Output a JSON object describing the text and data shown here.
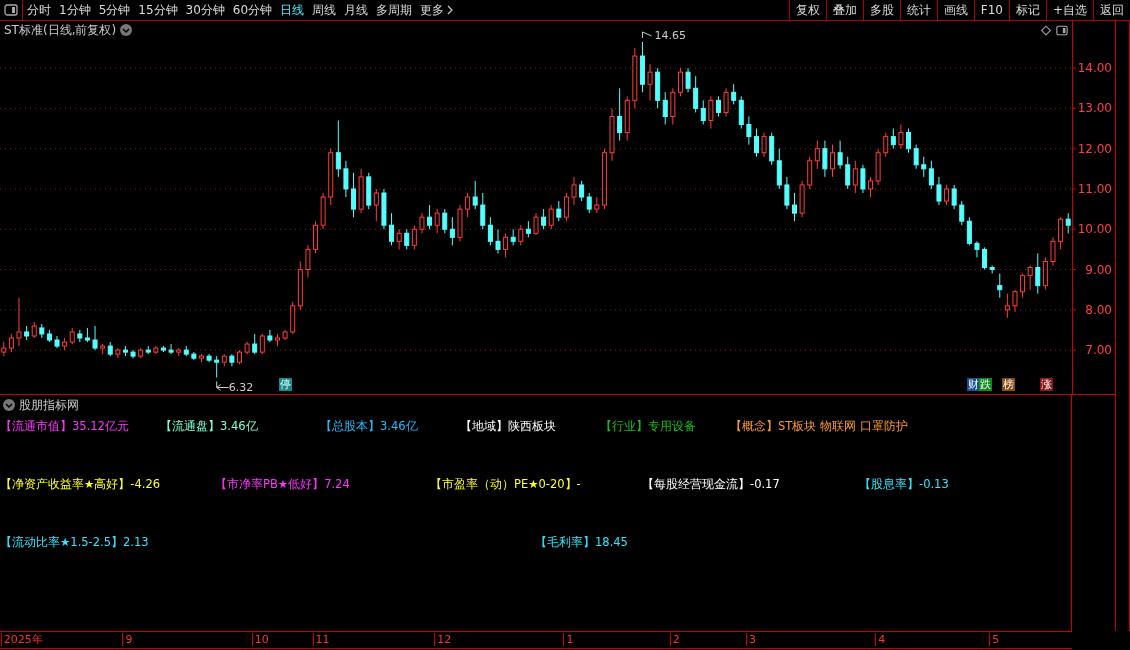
{
  "toolbar": {
    "periods": [
      {
        "label": "分时",
        "selected": false
      },
      {
        "label": "1分钟",
        "selected": false
      },
      {
        "label": "5分钟",
        "selected": false
      },
      {
        "label": "15分钟",
        "selected": false
      },
      {
        "label": "30分钟",
        "selected": false
      },
      {
        "label": "60分钟",
        "selected": false
      },
      {
        "label": "日线",
        "selected": true
      },
      {
        "label": "周线",
        "selected": false
      },
      {
        "label": "月线",
        "selected": false
      },
      {
        "label": "多周期",
        "selected": false
      }
    ],
    "more": "更多",
    "buttons": [
      "复权",
      "叠加",
      "多股",
      "统计",
      "画线",
      "F10",
      "标记",
      "+自选",
      "返回"
    ]
  },
  "chart": {
    "title": "ST标准(日线,前复权)",
    "chart_data": {
      "type": "candlestick",
      "grid": true,
      "ohlc": [
        [
          6.95,
          7.2,
          6.85,
          7.05
        ],
        [
          7.05,
          7.4,
          6.95,
          7.3
        ],
        [
          7.3,
          8.3,
          7.1,
          7.45
        ],
        [
          7.45,
          7.6,
          7.25,
          7.35
        ],
        [
          7.35,
          7.7,
          7.3,
          7.6
        ],
        [
          7.55,
          7.65,
          7.3,
          7.4
        ],
        [
          7.4,
          7.5,
          7.2,
          7.25
        ],
        [
          7.25,
          7.35,
          7.05,
          7.1
        ],
        [
          7.1,
          7.3,
          7.0,
          7.2
        ],
        [
          7.2,
          7.55,
          7.15,
          7.45
        ],
        [
          7.4,
          7.5,
          7.2,
          7.3
        ],
        [
          7.3,
          7.55,
          7.2,
          7.25
        ],
        [
          7.25,
          7.6,
          7.0,
          7.05
        ],
        [
          7.05,
          7.15,
          6.9,
          7.1
        ],
        [
          7.1,
          7.2,
          6.85,
          6.9
        ],
        [
          6.9,
          7.05,
          6.8,
          7.0
        ],
        [
          7.0,
          7.1,
          6.85,
          6.95
        ],
        [
          6.95,
          7.0,
          6.8,
          6.85
        ],
        [
          6.85,
          7.05,
          6.8,
          7.0
        ],
        [
          7.0,
          7.1,
          6.9,
          6.95
        ],
        [
          6.95,
          7.1,
          6.9,
          7.05
        ],
        [
          7.05,
          7.1,
          6.95,
          7.0
        ],
        [
          7.0,
          7.15,
          6.9,
          6.95
        ],
        [
          6.95,
          7.05,
          6.85,
          7.0
        ],
        [
          7.0,
          7.1,
          6.85,
          6.9
        ],
        [
          6.9,
          6.95,
          6.75,
          6.8
        ],
        [
          6.8,
          6.9,
          6.7,
          6.85
        ],
        [
          6.85,
          6.9,
          6.7,
          6.75
        ],
        [
          6.75,
          6.85,
          6.32,
          6.7
        ],
        [
          6.7,
          6.9,
          6.6,
          6.85
        ],
        [
          6.85,
          6.9,
          6.6,
          6.7
        ],
        [
          6.7,
          7.0,
          6.65,
          6.95
        ],
        [
          6.95,
          7.2,
          6.9,
          7.15
        ],
        [
          7.15,
          7.4,
          6.9,
          6.95
        ],
        [
          6.95,
          7.4,
          6.9,
          7.35
        ],
        [
          7.35,
          7.5,
          7.2,
          7.25
        ],
        [
          7.25,
          7.4,
          7.1,
          7.3
        ],
        [
          7.3,
          7.5,
          7.25,
          7.45
        ],
        [
          7.45,
          8.2,
          7.4,
          8.1
        ],
        [
          8.1,
          9.2,
          8.0,
          9.0
        ],
        [
          9.0,
          9.6,
          8.8,
          9.5
        ],
        [
          9.5,
          10.2,
          9.4,
          10.1
        ],
        [
          10.1,
          10.9,
          10.0,
          10.8
        ],
        [
          10.8,
          12.0,
          10.6,
          11.9
        ],
        [
          11.9,
          12.7,
          11.3,
          11.5
        ],
        [
          11.5,
          11.7,
          10.8,
          11.0
        ],
        [
          11.0,
          11.4,
          10.3,
          10.5
        ],
        [
          10.5,
          11.5,
          10.4,
          11.3
        ],
        [
          11.3,
          11.4,
          10.5,
          10.6
        ],
        [
          10.6,
          11.0,
          10.2,
          10.9
        ],
        [
          10.9,
          11.0,
          10.0,
          10.1
        ],
        [
          10.1,
          10.4,
          9.6,
          9.7
        ],
        [
          9.7,
          10.0,
          9.5,
          9.9
        ],
        [
          9.9,
          10.0,
          9.5,
          9.6
        ],
        [
          9.6,
          10.1,
          9.5,
          10.0
        ],
        [
          10.0,
          10.4,
          9.9,
          10.3
        ],
        [
          10.3,
          10.6,
          10.0,
          10.1
        ],
        [
          10.1,
          10.5,
          9.9,
          10.4
        ],
        [
          10.4,
          10.5,
          9.9,
          10.0
        ],
        [
          10.0,
          10.3,
          9.6,
          9.8
        ],
        [
          9.8,
          10.6,
          9.7,
          10.5
        ],
        [
          10.5,
          10.9,
          10.3,
          10.8
        ],
        [
          10.8,
          11.2,
          10.5,
          10.6
        ],
        [
          10.6,
          10.9,
          10.0,
          10.1
        ],
        [
          10.1,
          10.3,
          9.6,
          9.7
        ],
        [
          9.7,
          10.0,
          9.4,
          9.5
        ],
        [
          9.5,
          9.9,
          9.3,
          9.8
        ],
        [
          9.8,
          10.0,
          9.6,
          9.7
        ],
        [
          9.7,
          10.1,
          9.6,
          10.0
        ],
        [
          10.0,
          10.2,
          9.8,
          9.9
        ],
        [
          9.9,
          10.4,
          9.85,
          10.3
        ],
        [
          10.3,
          10.5,
          10.0,
          10.1
        ],
        [
          10.1,
          10.6,
          10.0,
          10.5
        ],
        [
          10.5,
          10.7,
          10.2,
          10.3
        ],
        [
          10.3,
          10.9,
          10.2,
          10.8
        ],
        [
          10.8,
          11.3,
          10.6,
          11.1
        ],
        [
          11.1,
          11.2,
          10.7,
          10.8
        ],
        [
          10.8,
          10.9,
          10.4,
          10.5
        ],
        [
          10.5,
          10.8,
          10.4,
          10.6
        ],
        [
          10.6,
          12.0,
          10.5,
          11.9
        ],
        [
          11.9,
          13.0,
          11.7,
          12.8
        ],
        [
          12.8,
          13.5,
          12.2,
          12.4
        ],
        [
          12.4,
          13.3,
          12.2,
          13.2
        ],
        [
          13.2,
          14.5,
          13.0,
          14.3
        ],
        [
          14.3,
          14.65,
          13.4,
          13.6
        ],
        [
          13.6,
          14.1,
          13.2,
          13.9
        ],
        [
          13.9,
          14.0,
          13.0,
          13.2
        ],
        [
          13.2,
          13.4,
          12.6,
          12.8
        ],
        [
          12.8,
          13.5,
          12.6,
          13.4
        ],
        [
          13.4,
          14.0,
          13.3,
          13.9
        ],
        [
          13.9,
          14.0,
          13.4,
          13.5
        ],
        [
          13.5,
          13.8,
          12.9,
          13.0
        ],
        [
          13.0,
          13.2,
          12.6,
          12.7
        ],
        [
          12.7,
          13.3,
          12.5,
          13.2
        ],
        [
          13.2,
          13.3,
          12.8,
          12.9
        ],
        [
          12.9,
          13.5,
          12.8,
          13.4
        ],
        [
          13.4,
          13.6,
          13.1,
          13.2
        ],
        [
          13.2,
          13.3,
          12.5,
          12.6
        ],
        [
          12.6,
          12.8,
          12.1,
          12.3
        ],
        [
          12.3,
          12.5,
          11.8,
          11.9
        ],
        [
          11.9,
          12.4,
          11.8,
          12.3
        ],
        [
          12.3,
          12.4,
          11.6,
          11.7
        ],
        [
          11.7,
          12.0,
          11.0,
          11.1
        ],
        [
          11.1,
          11.3,
          10.5,
          10.6
        ],
        [
          10.6,
          10.9,
          10.2,
          10.4
        ],
        [
          10.4,
          11.2,
          10.3,
          11.1
        ],
        [
          11.1,
          11.8,
          11.0,
          11.7
        ],
        [
          11.7,
          12.2,
          11.5,
          12.0
        ],
        [
          12.0,
          12.2,
          11.3,
          11.5
        ],
        [
          11.5,
          12.1,
          11.3,
          11.9
        ],
        [
          11.9,
          12.2,
          11.5,
          11.6
        ],
        [
          11.6,
          11.8,
          11.0,
          11.1
        ],
        [
          11.1,
          11.7,
          10.9,
          11.5
        ],
        [
          11.5,
          11.6,
          10.9,
          11.0
        ],
        [
          11.0,
          11.3,
          10.8,
          11.2
        ],
        [
          11.2,
          12.0,
          11.1,
          11.9
        ],
        [
          11.9,
          12.4,
          11.8,
          12.3
        ],
        [
          12.3,
          12.5,
          12.0,
          12.1
        ],
        [
          12.1,
          12.6,
          12.0,
          12.4
        ],
        [
          12.4,
          12.5,
          11.9,
          12.0
        ],
        [
          12.0,
          12.1,
          11.5,
          11.6
        ],
        [
          11.6,
          11.8,
          11.3,
          11.5
        ],
        [
          11.5,
          11.7,
          11.0,
          11.1
        ],
        [
          11.1,
          11.3,
          10.6,
          10.7
        ],
        [
          10.7,
          11.1,
          10.6,
          11.0
        ],
        [
          11.0,
          11.1,
          10.5,
          10.6
        ],
        [
          10.6,
          10.7,
          10.1,
          10.2
        ],
        [
          10.2,
          10.3,
          9.6,
          9.65
        ],
        [
          9.65,
          9.7,
          9.3,
          9.5
        ],
        [
          9.5,
          9.55,
          9.0,
          9.05
        ],
        [
          9.05,
          9.1,
          8.9,
          9.0
        ],
        [
          8.6,
          8.9,
          8.3,
          8.5
        ],
        [
          8.0,
          8.4,
          7.8,
          8.1
        ],
        [
          8.1,
          8.5,
          7.95,
          8.45
        ],
        [
          8.45,
          8.9,
          8.3,
          8.85
        ],
        [
          8.85,
          9.1,
          8.5,
          9.05
        ],
        [
          9.05,
          9.4,
          8.4,
          8.6
        ],
        [
          8.6,
          9.3,
          8.5,
          9.2
        ],
        [
          9.2,
          9.8,
          9.1,
          9.7
        ],
        [
          9.7,
          10.3,
          9.5,
          10.25
        ],
        [
          10.25,
          10.4,
          9.9,
          10.1
        ]
      ],
      "ylim": [
        5.91,
        15.17
      ],
      "yticks": [
        {
          "value": 14,
          "label": "14.00"
        },
        {
          "value": 13,
          "label": "13.00"
        },
        {
          "value": 12,
          "label": "12.00"
        },
        {
          "value": 11,
          "label": "11.00"
        },
        {
          "value": 10,
          "label": "10.00"
        },
        {
          "value": 9,
          "label": "9.00"
        },
        {
          "value": 8,
          "label": "8.00"
        },
        {
          "value": 7,
          "label": "7.00"
        }
      ],
      "annotations": [
        "14.65",
        "6.32"
      ]
    },
    "badges": [
      {
        "label": "停",
        "color": "#138a8a"
      },
      {
        "label": "财",
        "color": "#1a4f8c"
      },
      {
        "label": "跌",
        "color": "#0e8a1a"
      },
      {
        "label": "榜",
        "color": "#8a4b12"
      },
      {
        "label": "涨",
        "color": "#8c1414"
      }
    ]
  },
  "indicator": {
    "title": "股朋指标网",
    "items": [
      {
        "label": "【流通市值】",
        "value": "35.12亿元",
        "color": "#ff33ff"
      },
      {
        "label": "【流通盘】",
        "value": "3.46亿",
        "color": "#80ffd0"
      },
      {
        "label": "【总股本】",
        "value": "3.46亿",
        "color": "#22bbff"
      },
      {
        "label": "【地域】",
        "value": "陕西板块",
        "color": "#ffffff"
      },
      {
        "label": "【行业】",
        "value": "专用设备",
        "color": "#18c018"
      },
      {
        "label": "【概念】",
        "value": "ST板块 物联网 口罩防护",
        "color": "#ff9a30"
      },
      {
        "label": "【净资产收益率★高好】",
        "value": "-4.26",
        "color": "#ffff33"
      },
      {
        "label": "【市净率PB★低好】",
        "value": "7.24",
        "color": "#ff33ff"
      },
      {
        "label": "【市盈率（动）PE★0-20】",
        "value": "-",
        "color": "#ffff33"
      },
      {
        "label": "【每股经营现金流】",
        "value": "-0.17",
        "color": "#ffffff"
      },
      {
        "label": "【股息率】",
        "value": "-0.13",
        "color": "#33e6ff"
      },
      {
        "label": "【流动比率★1.5-2.5】",
        "value": "2.13",
        "color": "#33e6ff"
      },
      {
        "label": "【毛利率】",
        "value": "18.45",
        "color": "#33e6ff"
      }
    ]
  },
  "time_axis": [
    "2025年",
    "9",
    "10",
    "11",
    "12",
    "1",
    "2",
    "3",
    "4",
    "5"
  ]
}
